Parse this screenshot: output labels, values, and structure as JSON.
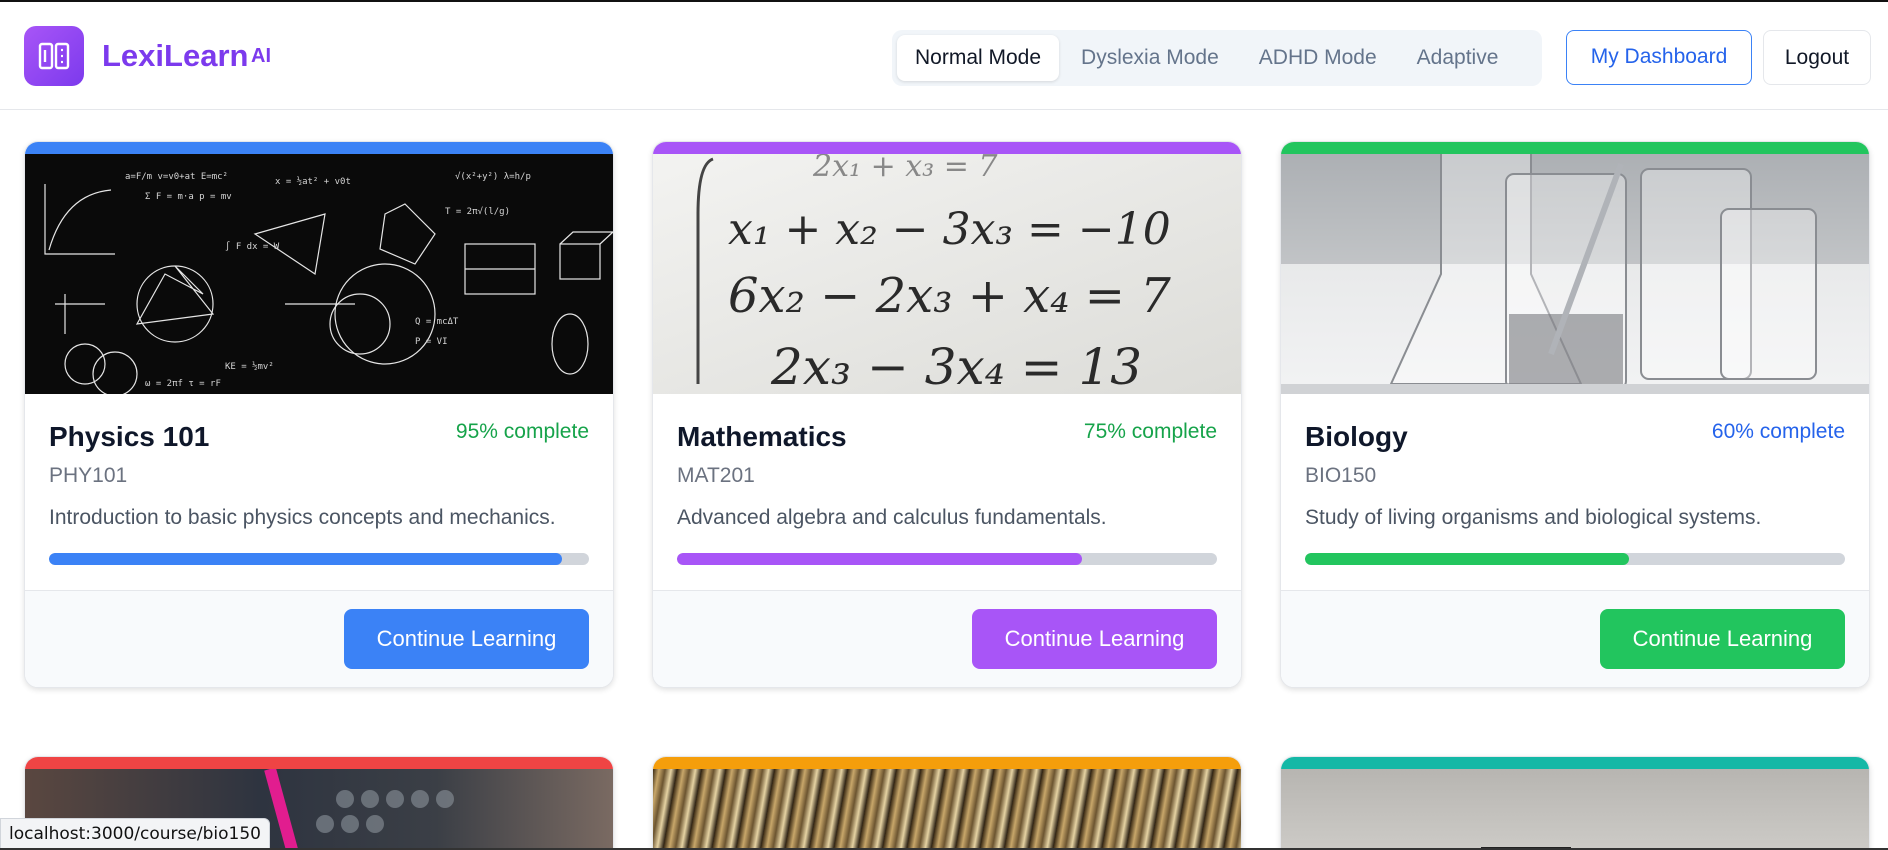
{
  "app": {
    "name": "LexiLearn",
    "suffix": "AI"
  },
  "modes": [
    {
      "label": "Normal Mode",
      "active": true
    },
    {
      "label": "Dyslexia Mode",
      "active": false
    },
    {
      "label": "ADHD Mode",
      "active": false
    },
    {
      "label": "Adaptive",
      "active": false
    }
  ],
  "header": {
    "dashboard_label": "My Dashboard",
    "logout_label": "Logout"
  },
  "courses": [
    {
      "title": "Physics 101",
      "code": "PHY101",
      "progress_label": "95% complete",
      "progress": 0.95,
      "description": "Introduction to basic physics concepts and mechanics.",
      "button": "Continue Learning",
      "accent": "#3b82f6",
      "progress_color": "#16a34a",
      "image": "physics-formulas-chalkboard"
    },
    {
      "title": "Mathematics",
      "code": "MAT201",
      "progress_label": "75% complete",
      "progress": 0.75,
      "description": "Advanced algebra and calculus fundamentals.",
      "button": "Continue Learning",
      "accent": "#a855f7",
      "progress_color": "#16a34a",
      "image": "linear-equations"
    },
    {
      "title": "Biology",
      "code": "BIO150",
      "progress_label": "60% complete",
      "progress": 0.6,
      "description": "Study of living organisms and biological systems.",
      "button": "Continue Learning",
      "accent": "#22c55e",
      "progress_color": "#2563eb",
      "image": "lab-glassware"
    }
  ],
  "next_row_accents": [
    "#ef4444",
    "#f59e0b",
    "#14b8a6"
  ],
  "status_bar": "localhost:3000/course/bio150"
}
